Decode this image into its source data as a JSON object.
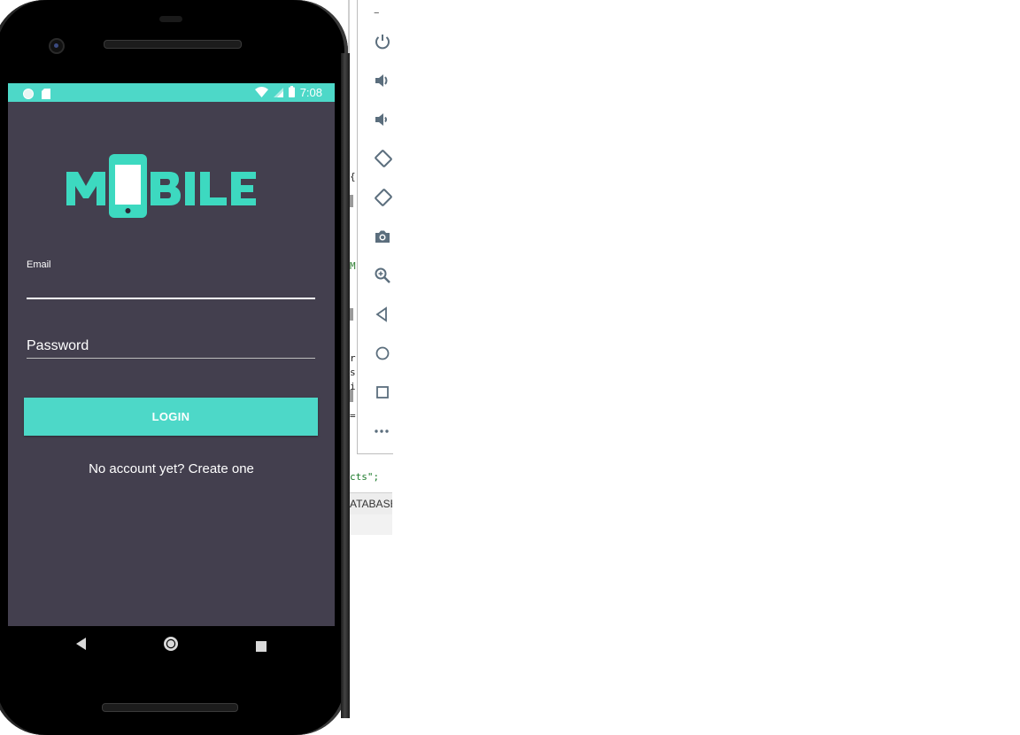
{
  "ide": {
    "code_fragments": [
      "{",
      "M",
      "r",
      "s",
      "i",
      "=",
      "cts\";"
    ],
    "tab_label": "ATABASE_"
  },
  "emulator_toolbar": {
    "items": [
      {
        "icon": "power-icon"
      },
      {
        "icon": "volume-up-icon"
      },
      {
        "icon": "volume-down-icon"
      },
      {
        "icon": "rotate-left-icon"
      },
      {
        "icon": "rotate-right-icon"
      },
      {
        "icon": "camera-icon"
      },
      {
        "icon": "zoom-icon"
      },
      {
        "icon": "back-icon"
      },
      {
        "icon": "home-icon"
      },
      {
        "icon": "overview-icon"
      },
      {
        "icon": "more-icon"
      }
    ],
    "minimize_label": "–"
  },
  "status_bar": {
    "time": "7:08",
    "color": "#4dd8c8"
  },
  "app": {
    "logo_text": "MOBILE",
    "background": "#433f4e",
    "accent": "#4dd8c8",
    "email": {
      "label": "Email",
      "value": ""
    },
    "password": {
      "placeholder": "Password",
      "value": ""
    },
    "login_button": "LOGIN",
    "signup_link": "No account yet? Create one"
  },
  "nav_bar": {
    "buttons": [
      "back",
      "home",
      "recents"
    ]
  }
}
